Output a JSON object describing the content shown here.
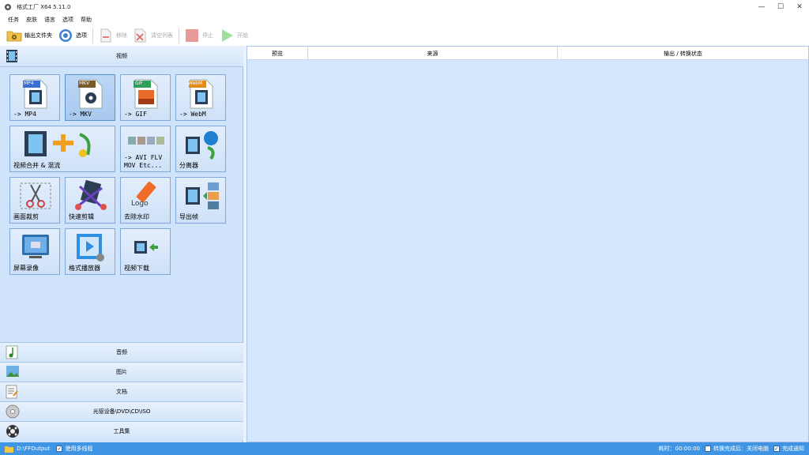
{
  "window": {
    "title": "格式工厂 X64 5.11.0",
    "controls": {
      "minimize": "—",
      "maximize": "☐",
      "close": "✕"
    }
  },
  "menu": [
    "任务",
    "皮肤",
    "语言",
    "选项",
    "帮助"
  ],
  "toolbar": {
    "output_folder": "输出文件夹",
    "options": "选项",
    "remove": "移除",
    "clear_list": "清空列表",
    "stop": "停止",
    "start": "开始"
  },
  "left_panel": {
    "video_header": "视频",
    "tiles": [
      {
        "label": "-> MP4",
        "badge": "MP4",
        "badge_color": "#3a6fd1"
      },
      {
        "label": "-> MKV",
        "badge": "MKV",
        "badge_color": "#7a5a2a"
      },
      {
        "label": "-> GIF",
        "badge": "GIF",
        "badge_color": "#2ea05a"
      },
      {
        "label": "-> WebM",
        "badge": "WebM",
        "badge_color": "#e28a1a"
      },
      {
        "label": "视频合并 & 混流"
      },
      {
        "label": "-> AVI FLV\nMOV Etc..."
      },
      {
        "label": "分离器"
      },
      {
        "label": "画面裁剪"
      },
      {
        "label": "快速剪辑"
      },
      {
        "label": "去除水印",
        "art_text": "Logo"
      },
      {
        "label": "导出帧"
      },
      {
        "label": "屏幕录像"
      },
      {
        "label": "格式播放器"
      },
      {
        "label": "视频下载"
      }
    ],
    "categories": [
      "音频",
      "图片",
      "文档",
      "光驱设备\\DVD\\CD\\ISO",
      "工具集"
    ]
  },
  "task_table": {
    "columns": [
      "预览",
      "来源",
      "输出 / 转换状态"
    ]
  },
  "statusbar": {
    "output_path": "D:\\FFOutput",
    "multithread_label": "使用多线程",
    "multithread_checked": "✓",
    "elapsed": "耗时：00:00:00",
    "after_convert_label": "转换完成后：关闭电脑",
    "after_convert_checked": "",
    "notify_label": "完成通知",
    "notify_checked": "✓"
  },
  "colors": {
    "panel_bg": "#cfe3fa",
    "right_bg": "#d5e7fc",
    "statusbar": "#3f95e3",
    "tile_border": "#7fa9dc"
  }
}
